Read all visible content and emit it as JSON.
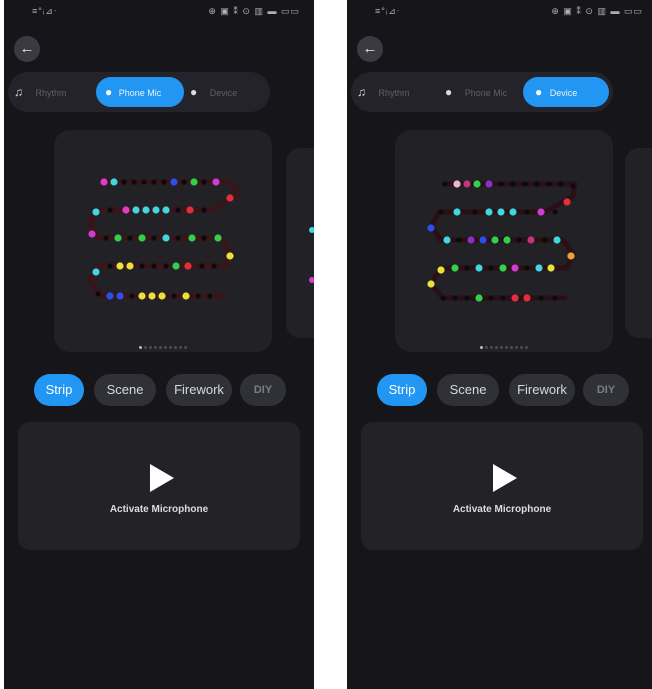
{
  "status_bar": {
    "left_text": "≡°ᵢ⊿ᐧ",
    "right_text": "⊕ ▣ ⁑ ⊙ ▥ ▬ ▭▭"
  },
  "icons": {
    "back": "back-arrow-icon",
    "music": "music-note-icon",
    "mic": "microphone-icon"
  },
  "colors": {
    "accent": "#2196f3",
    "background": "#16161a",
    "card": "#212126"
  },
  "screens": [
    {
      "mode_tabs": [
        {
          "label": "Rhythm",
          "active": false
        },
        {
          "label": "Phone Mic",
          "active": true
        },
        {
          "label": "Device",
          "active": false
        }
      ],
      "effect_tabs": [
        "Strip",
        "Scene",
        "Firework",
        "DIY"
      ],
      "selected_effect": "Strip",
      "activate_label": "Activate Microphone",
      "pager": {
        "count": 10,
        "current": 1
      }
    },
    {
      "mode_tabs": [
        {
          "label": "Rhythm",
          "active": false
        },
        {
          "label": "Phone Mic",
          "active": false
        },
        {
          "label": "Device",
          "active": true
        }
      ],
      "effect_tabs": [
        "Strip",
        "Scene",
        "Firework",
        "DIY"
      ],
      "selected_effect": "Strip",
      "activate_label": "Activate Microphone",
      "pager": {
        "count": 10,
        "current": 1
      }
    }
  ]
}
